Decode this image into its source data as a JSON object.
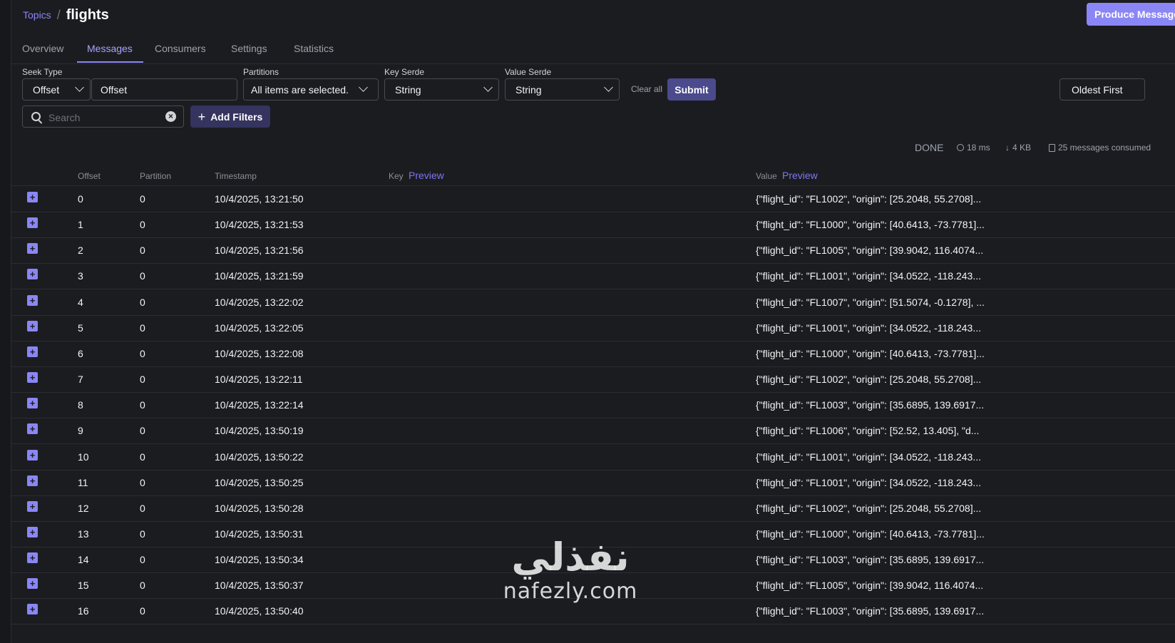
{
  "header": {
    "breadcrumb_link": "Topics",
    "separator": "/",
    "title": "flights",
    "produce_button": "Produce Message"
  },
  "tabs": [
    {
      "label": "Overview"
    },
    {
      "label": "Messages",
      "active": true
    },
    {
      "label": "Consumers"
    },
    {
      "label": "Settings"
    },
    {
      "label": "Statistics"
    }
  ],
  "filters": {
    "seek_type_label": "Seek Type",
    "seek_type_value": "Offset",
    "offset_value": "Offset",
    "partitions_label": "Partitions",
    "partitions_value": "All items are selected.",
    "key_serde_label": "Key Serde",
    "key_serde_value": "String",
    "value_serde_label": "Value Serde",
    "value_serde_value": "String",
    "clear_all": "Clear all",
    "submit": "Submit",
    "order_value": "Oldest First",
    "search_placeholder": "Search",
    "add_filters": "Add Filters"
  },
  "stats": {
    "status": "DONE",
    "elapsed": "18 ms",
    "bytes": "4 KB",
    "messages": "25 messages consumed"
  },
  "table": {
    "columns": {
      "offset": "Offset",
      "partition": "Partition",
      "timestamp": "Timestamp",
      "key": "Key",
      "key_preview": "Preview",
      "value": "Value",
      "value_preview": "Preview"
    },
    "rows": [
      {
        "offset": "0",
        "partition": "0",
        "timestamp": "10/4/2025, 13:21:50",
        "key": "",
        "value": "{\"flight_id\": \"FL1002\", \"origin\": [25.2048, 55.2708]..."
      },
      {
        "offset": "1",
        "partition": "0",
        "timestamp": "10/4/2025, 13:21:53",
        "key": "",
        "value": "{\"flight_id\": \"FL1000\", \"origin\": [40.6413, -73.7781]..."
      },
      {
        "offset": "2",
        "partition": "0",
        "timestamp": "10/4/2025, 13:21:56",
        "key": "",
        "value": "{\"flight_id\": \"FL1005\", \"origin\": [39.9042, 116.4074..."
      },
      {
        "offset": "3",
        "partition": "0",
        "timestamp": "10/4/2025, 13:21:59",
        "key": "",
        "value": "{\"flight_id\": \"FL1001\", \"origin\": [34.0522, -118.243..."
      },
      {
        "offset": "4",
        "partition": "0",
        "timestamp": "10/4/2025, 13:22:02",
        "key": "",
        "value": "{\"flight_id\": \"FL1007\", \"origin\": [51.5074, -0.1278], ..."
      },
      {
        "offset": "5",
        "partition": "0",
        "timestamp": "10/4/2025, 13:22:05",
        "key": "",
        "value": "{\"flight_id\": \"FL1001\", \"origin\": [34.0522, -118.243..."
      },
      {
        "offset": "6",
        "partition": "0",
        "timestamp": "10/4/2025, 13:22:08",
        "key": "",
        "value": "{\"flight_id\": \"FL1000\", \"origin\": [40.6413, -73.7781]..."
      },
      {
        "offset": "7",
        "partition": "0",
        "timestamp": "10/4/2025, 13:22:11",
        "key": "",
        "value": "{\"flight_id\": \"FL1002\", \"origin\": [25.2048, 55.2708]..."
      },
      {
        "offset": "8",
        "partition": "0",
        "timestamp": "10/4/2025, 13:22:14",
        "key": "",
        "value": "{\"flight_id\": \"FL1003\", \"origin\": [35.6895, 139.6917..."
      },
      {
        "offset": "9",
        "partition": "0",
        "timestamp": "10/4/2025, 13:50:19",
        "key": "",
        "value": "{\"flight_id\": \"FL1006\", \"origin\": [52.52, 13.405], \"d..."
      },
      {
        "offset": "10",
        "partition": "0",
        "timestamp": "10/4/2025, 13:50:22",
        "key": "",
        "value": "{\"flight_id\": \"FL1001\", \"origin\": [34.0522, -118.243..."
      },
      {
        "offset": "11",
        "partition": "0",
        "timestamp": "10/4/2025, 13:50:25",
        "key": "",
        "value": "{\"flight_id\": \"FL1001\", \"origin\": [34.0522, -118.243..."
      },
      {
        "offset": "12",
        "partition": "0",
        "timestamp": "10/4/2025, 13:50:28",
        "key": "",
        "value": "{\"flight_id\": \"FL1002\", \"origin\": [25.2048, 55.2708]..."
      },
      {
        "offset": "13",
        "partition": "0",
        "timestamp": "10/4/2025, 13:50:31",
        "key": "",
        "value": "{\"flight_id\": \"FL1000\", \"origin\": [40.6413, -73.7781]..."
      },
      {
        "offset": "14",
        "partition": "0",
        "timestamp": "10/4/2025, 13:50:34",
        "key": "",
        "value": "{\"flight_id\": \"FL1003\", \"origin\": [35.6895, 139.6917..."
      },
      {
        "offset": "15",
        "partition": "0",
        "timestamp": "10/4/2025, 13:50:37",
        "key": "",
        "value": "{\"flight_id\": \"FL1005\", \"origin\": [39.9042, 116.4074..."
      },
      {
        "offset": "16",
        "partition": "0",
        "timestamp": "10/4/2025, 13:50:40",
        "key": "",
        "value": "{\"flight_id\": \"FL1003\", \"origin\": [35.6895, 139.6917..."
      }
    ]
  },
  "watermark": {
    "arabic": "نفذلي",
    "latin": "nafezly.com"
  },
  "colors": {
    "background": "#1b1c20",
    "accent": "#8b86f5",
    "border": "#2c2d33"
  }
}
